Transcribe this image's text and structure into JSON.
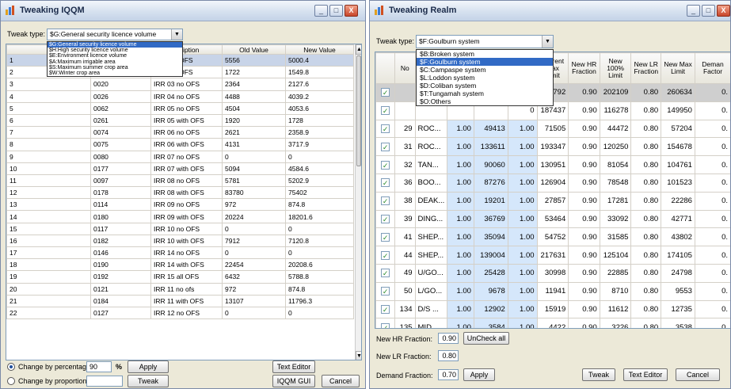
{
  "win1": {
    "title": "Tweaking IQQM",
    "controls": {
      "minimize": "_",
      "maximize": "□",
      "close": "X"
    },
    "tweak_type_label": "Tweak type:",
    "tweak_type_value": "$G:General security licence volume",
    "dropdown_options": [
      "$G:General security licence volume",
      "$H:High security licence volume",
      "$E:Environment licence volume",
      "$A:Maximum irrigable area",
      "$S:Maximum summer crop area",
      "$W:Winter crop area"
    ],
    "columns": [
      "",
      "",
      "scription",
      "Old Value",
      "New Value"
    ],
    "rows": [
      [
        "1",
        "",
        "R 01 no OFS",
        "5556",
        "5000.4"
      ],
      [
        "2",
        "",
        "R 02 no OFS",
        "1722",
        "1549.8"
      ],
      [
        "3",
        "0020",
        "IRR 03 no OFS",
        "2364",
        "2127.6"
      ],
      [
        "4",
        "0026",
        "IRR 04 no OFS",
        "4488",
        "4039.2"
      ],
      [
        "5",
        "0062",
        "IRR 05 no OFS",
        "4504",
        "4053.6"
      ],
      [
        "6",
        "0261",
        "IRR 05 with OFS",
        "1920",
        "1728"
      ],
      [
        "7",
        "0074",
        "IRR 06 no OFS",
        "2621",
        "2358.9"
      ],
      [
        "8",
        "0075",
        "IRR 06 with OFS",
        "4131",
        "3717.9"
      ],
      [
        "9",
        "0080",
        "IRR 07 no OFS",
        "0",
        "0"
      ],
      [
        "10",
        "0177",
        "IRR 07 with OFS",
        "5094",
        "4584.6"
      ],
      [
        "11",
        "0097",
        "IRR 08 no OFS",
        "5781",
        "5202.9"
      ],
      [
        "12",
        "0178",
        "IRR 08 with OFS",
        "83780",
        "75402"
      ],
      [
        "13",
        "0114",
        "IRR 09 no OFS",
        "972",
        "874.8"
      ],
      [
        "14",
        "0180",
        "IRR 09 with OFS",
        "20224",
        "18201.6"
      ],
      [
        "15",
        "0117",
        "IRR 10 no OFS",
        "0",
        "0"
      ],
      [
        "16",
        "0182",
        "IRR 10 with OFS",
        "7912",
        "7120.8"
      ],
      [
        "17",
        "0146",
        "IRR 14 no OFS",
        "0",
        "0"
      ],
      [
        "18",
        "0190",
        "IRR 14 with OFS",
        "22454",
        "20208.6"
      ],
      [
        "19",
        "0192",
        "IRR 15 all OFS",
        "6432",
        "5788.8"
      ],
      [
        "20",
        "0121",
        "IRR 11 no ofs",
        "972",
        "874.8"
      ],
      [
        "21",
        "0184",
        "IRR 11 with OFS",
        "13107",
        "11796.3"
      ],
      [
        "22",
        "0127",
        "IRR 12 no OFS",
        "0",
        "0"
      ]
    ],
    "change_percentage_label": "Change by percentage:",
    "percentage_value": "90",
    "percent_sign": "%",
    "apply_label": "Apply",
    "change_proportion_label": "Change by proportion:",
    "proportion_value": "",
    "tweak_label": "Tweak",
    "text_editor_label": "Text Editor",
    "iqqm_gui_label": "IQQM GUI",
    "cancel_label": "Cancel"
  },
  "win2": {
    "title": "Tweaking Realm",
    "controls": {
      "minimize": "_",
      "maximize": "□",
      "close": "X"
    },
    "tweak_type_label": "Tweak type:",
    "tweak_type_value": "$F:Goulburn system",
    "dropdown_options": [
      "$B:Broken system",
      "$F:Goulburn system",
      "$C:Campaspe system",
      "$L:Loddon system",
      "$D:Coliban system",
      "$T:Tungamah system",
      "$O:Others"
    ],
    "columns": [
      "",
      "No",
      "",
      "",
      "t\nn",
      "Current Max Limit",
      "New HR Fraction",
      "New 100% Limit",
      "New LR Fraction",
      "New Max Limit",
      "Deman Factor"
    ],
    "rows": [
      [
        "0",
        "325792",
        "0.90",
        "202109",
        "0.80",
        "260634",
        "0."
      ],
      [
        "0",
        "187437",
        "0.90",
        "116278",
        "0.80",
        "149950",
        "0."
      ],
      [
        "29",
        "ROC...",
        "1.00",
        "49413",
        "1.00",
        "71505",
        "0.90",
        "44472",
        "0.80",
        "57204",
        "0."
      ],
      [
        "31",
        "ROC...",
        "1.00",
        "133611",
        "1.00",
        "193347",
        "0.90",
        "120250",
        "0.80",
        "154678",
        "0."
      ],
      [
        "32",
        "TAN...",
        "1.00",
        "90060",
        "1.00",
        "130951",
        "0.90",
        "81054",
        "0.80",
        "104761",
        "0."
      ],
      [
        "36",
        "BOO...",
        "1.00",
        "87276",
        "1.00",
        "126904",
        "0.90",
        "78548",
        "0.80",
        "101523",
        "0."
      ],
      [
        "38",
        "DEAK...",
        "1.00",
        "19201",
        "1.00",
        "27857",
        "0.90",
        "17281",
        "0.80",
        "22286",
        "0."
      ],
      [
        "39",
        "DING...",
        "1.00",
        "36769",
        "1.00",
        "53464",
        "0.90",
        "33092",
        "0.80",
        "42771",
        "0."
      ],
      [
        "41",
        "SHEP...",
        "1.00",
        "35094",
        "1.00",
        "54752",
        "0.90",
        "31585",
        "0.80",
        "43802",
        "0."
      ],
      [
        "44",
        "SHEP...",
        "1.00",
        "139004",
        "1.00",
        "217631",
        "0.90",
        "125104",
        "0.80",
        "174105",
        "0."
      ],
      [
        "49",
        "U/GO...",
        "1.00",
        "25428",
        "1.00",
        "30998",
        "0.90",
        "22885",
        "0.80",
        "24798",
        "0."
      ],
      [
        "50",
        "L/GO...",
        "1.00",
        "9678",
        "1.00",
        "11941",
        "0.90",
        "8710",
        "0.80",
        "9553",
        "0."
      ],
      [
        "134",
        "D/S ...",
        "1.00",
        "12902",
        "1.00",
        "15919",
        "0.90",
        "11612",
        "0.80",
        "12735",
        "0."
      ],
      [
        "135",
        "MID ...",
        "1.00",
        "3584",
        "1.00",
        "4422",
        "0.90",
        "3226",
        "0.80",
        "3538",
        "0."
      ]
    ],
    "new_hr_label": "New HR Fraction:",
    "new_hr_value": "0.90",
    "uncheck_all_label": "UnCheck all",
    "new_lr_label": "New LR Fraction:",
    "new_lr_value": "0.80",
    "demand_label": "Demand Fraction:",
    "demand_value": "0.70",
    "apply_label": "Apply",
    "tweak_label": "Tweak",
    "text_editor_label": "Text Editor",
    "cancel_label": "Cancel",
    "checkmark": "✓"
  }
}
